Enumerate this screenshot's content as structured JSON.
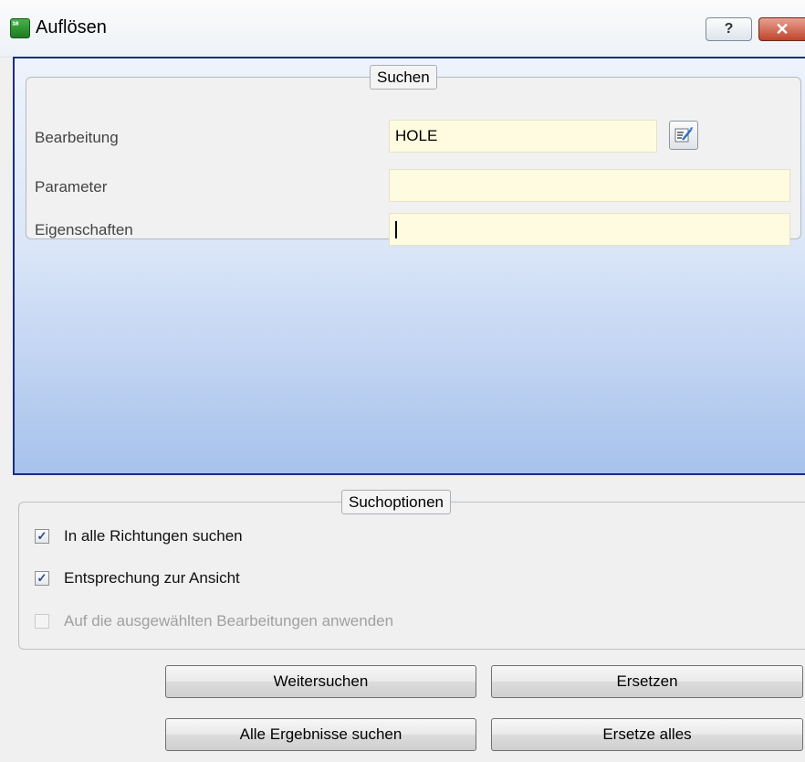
{
  "window": {
    "title": "Auflösen",
    "icon": "app-icon",
    "icon_glyph": "¹⁸",
    "help_glyph": "?",
    "close_glyph": "✕"
  },
  "search": {
    "legend": "Suchen",
    "fields": [
      {
        "label": "Bearbeitung",
        "value": "HOLE"
      },
      {
        "label": "Parameter",
        "value": ""
      },
      {
        "label": "Eigenschaften",
        "value": ""
      }
    ],
    "pick_button_icon": "edit-list-icon"
  },
  "options": {
    "legend": "Suchoptionen",
    "items": [
      {
        "label": "In alle Richtungen suchen",
        "checked": true,
        "enabled": true
      },
      {
        "label": "Entsprechung zur Ansicht",
        "checked": true,
        "enabled": true
      },
      {
        "label": "Auf die ausgewählten Bearbeitungen anwenden",
        "checked": false,
        "enabled": false
      }
    ]
  },
  "buttons": {
    "find_next": "Weitersuchen",
    "replace": "Ersetzen",
    "find_all": "Alle Ergebnisse suchen",
    "replace_all": "Ersetze alles"
  },
  "colors": {
    "panel_border": "#1c2e80",
    "panel_gradient_bottom": "#a7c2ec",
    "input_background": "#fffbe0",
    "check_mark": "#2b4a85"
  }
}
